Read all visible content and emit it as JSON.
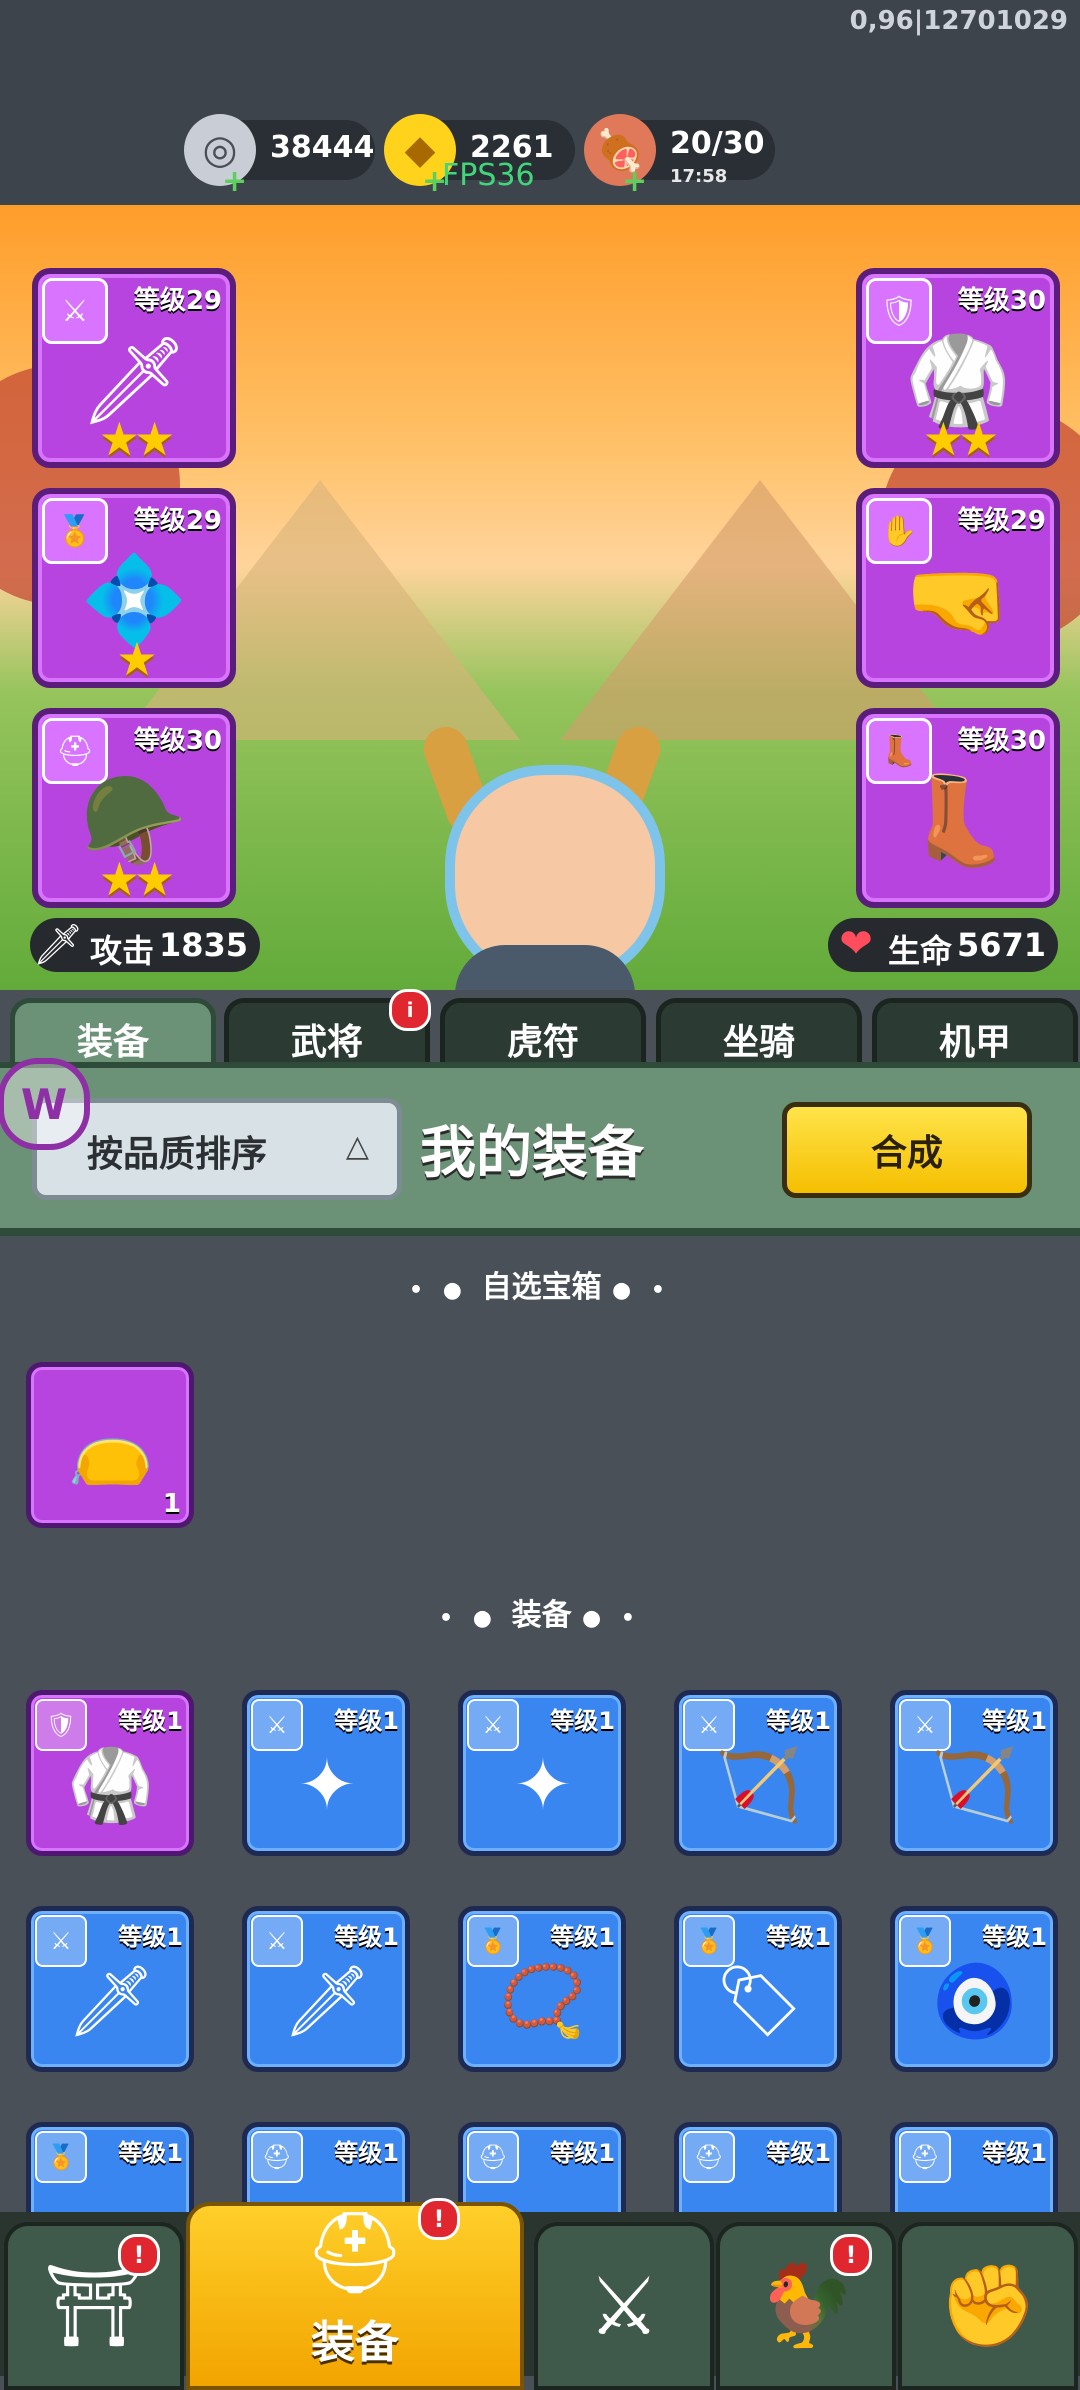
{
  "debug": {
    "build_text": "0,96|12701029",
    "fps_text": "FPS36"
  },
  "resources": {
    "silver": {
      "icon": "silver-coin-icon",
      "value": "38444"
    },
    "gold": {
      "icon": "gold-ingot-icon",
      "value": "2261"
    },
    "stamina": {
      "icon": "meat-icon",
      "value": "20/30",
      "timer": "17:58"
    }
  },
  "equipped": {
    "weapon": {
      "icon": "sword-icon",
      "level": "等级29",
      "stars": "★★"
    },
    "necklace": {
      "icon": "medal-icon",
      "level": "等级29",
      "stars": "★"
    },
    "helmet": {
      "icon": "helmet-icon",
      "level": "等级30",
      "stars": "★★"
    },
    "armor": {
      "icon": "armor-icon",
      "level": "等级30",
      "stars": "★★"
    },
    "gloves": {
      "icon": "gauntlet-icon",
      "level": "等级29",
      "stars": ""
    },
    "boots": {
      "icon": "boot-icon",
      "level": "等级30",
      "stars": ""
    }
  },
  "stats": {
    "attack": {
      "label": "攻击",
      "value": "1835"
    },
    "health": {
      "label": "生命",
      "value": "5671"
    }
  },
  "tabs": [
    {
      "label": "装备",
      "active": true
    },
    {
      "label": "武将",
      "badge": "i"
    },
    {
      "label": "虎符"
    },
    {
      "label": "坐骑"
    },
    {
      "label": "机甲"
    }
  ],
  "panel": {
    "sort_label": "按品质排序",
    "title": "我的装备",
    "merge_label": "合成"
  },
  "sections": {
    "chest": "自选宝箱",
    "equipment": "装备"
  },
  "chest_items": [
    {
      "count": "1"
    }
  ],
  "items": [
    {
      "level": "等级1"
    },
    {
      "level": "等级1"
    },
    {
      "level": "等级1"
    },
    {
      "level": "等级1"
    },
    {
      "level": "等级1"
    },
    {
      "level": "等级1"
    },
    {
      "level": "等级1"
    },
    {
      "level": "等级1"
    },
    {
      "level": "等级1"
    },
    {
      "level": "等级1"
    },
    {
      "level": "等级1"
    },
    {
      "level": "等级1"
    },
    {
      "level": "等级1"
    },
    {
      "level": "等级1"
    },
    {
      "level": "等级1"
    }
  ],
  "bottom_nav": {
    "active_label": "装备"
  },
  "colors": {
    "purple": "#b844e0",
    "blue": "#3a86f0",
    "accent": "#f5bf00"
  }
}
